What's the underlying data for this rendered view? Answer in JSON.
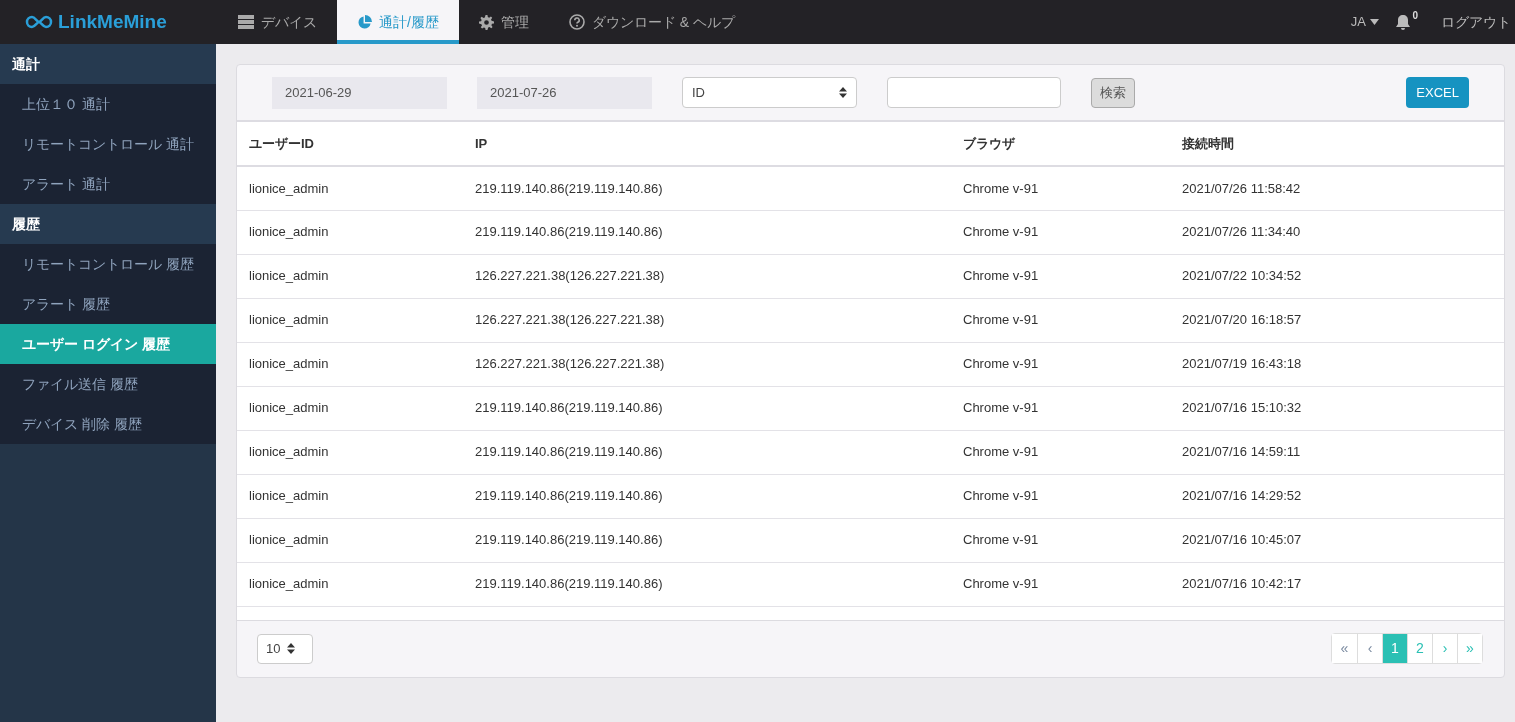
{
  "brand": "LinkMeMine",
  "nav_tabs": [
    {
      "label": "デバイス",
      "kind": "server",
      "selected": false
    },
    {
      "label": "通計/履歴",
      "kind": "pie",
      "selected": true
    },
    {
      "label": "管理",
      "kind": "gear",
      "selected": false
    },
    {
      "label": "ダウンロード & ヘルプ",
      "kind": "help",
      "selected": false
    }
  ],
  "language": "JA",
  "notification_count": "0",
  "logout": "ログアウト",
  "sidebar": [
    {
      "title": "通計",
      "items": [
        {
          "label": "上位１０ 通計",
          "selected": false
        },
        {
          "label": "リモートコントロール 通計",
          "selected": false
        },
        {
          "label": "アラート 通計",
          "selected": false
        }
      ]
    },
    {
      "title": "履歴",
      "items": [
        {
          "label": "リモートコントロール 履歴",
          "selected": false
        },
        {
          "label": "アラート 履歴",
          "selected": false
        },
        {
          "label": "ユーザー ログイン 履歴",
          "selected": true
        },
        {
          "label": "ファイル送信 履歴",
          "selected": false
        },
        {
          "label": "デバイス 削除 履歴",
          "selected": false
        }
      ]
    }
  ],
  "filters": {
    "start_date": "2021-06-29",
    "end_date": "2021-07-26",
    "search_field": "ID",
    "search_button": "検索",
    "export_button": "EXCEL"
  },
  "table": {
    "columns": [
      "ユーザーID",
      "IP",
      "ブラウザ",
      "接続時間"
    ],
    "rows": [
      [
        "lionice_admin",
        "219.119.140.86(219.119.140.86)",
        "Chrome v-91",
        "2021/07/26 11:58:42"
      ],
      [
        "lionice_admin",
        "219.119.140.86(219.119.140.86)",
        "Chrome v-91",
        "2021/07/26 11:34:40"
      ],
      [
        "lionice_admin",
        "126.227.221.38(126.227.221.38)",
        "Chrome v-91",
        "2021/07/22 10:34:52"
      ],
      [
        "lionice_admin",
        "126.227.221.38(126.227.221.38)",
        "Chrome v-91",
        "2021/07/20 16:18:57"
      ],
      [
        "lionice_admin",
        "126.227.221.38(126.227.221.38)",
        "Chrome v-91",
        "2021/07/19 16:43:18"
      ],
      [
        "lionice_admin",
        "219.119.140.86(219.119.140.86)",
        "Chrome v-91",
        "2021/07/16 15:10:32"
      ],
      [
        "lionice_admin",
        "219.119.140.86(219.119.140.86)",
        "Chrome v-91",
        "2021/07/16 14:59:11"
      ],
      [
        "lionice_admin",
        "219.119.140.86(219.119.140.86)",
        "Chrome v-91",
        "2021/07/16 14:29:52"
      ],
      [
        "lionice_admin",
        "219.119.140.86(219.119.140.86)",
        "Chrome v-91",
        "2021/07/16 10:45:07"
      ],
      [
        "lionice_admin",
        "219.119.140.86(219.119.140.86)",
        "Chrome v-91",
        "2021/07/16 10:42:17"
      ]
    ]
  },
  "page_size": "10",
  "pagination": [
    {
      "label": "«",
      "selected": false,
      "disabled": true
    },
    {
      "label": "‹",
      "selected": false,
      "disabled": true
    },
    {
      "label": "1",
      "selected": true,
      "disabled": false
    },
    {
      "label": "2",
      "selected": false,
      "disabled": false
    },
    {
      "label": "›",
      "selected": false,
      "disabled": false
    },
    {
      "label": "»",
      "selected": false,
      "disabled": false
    }
  ]
}
